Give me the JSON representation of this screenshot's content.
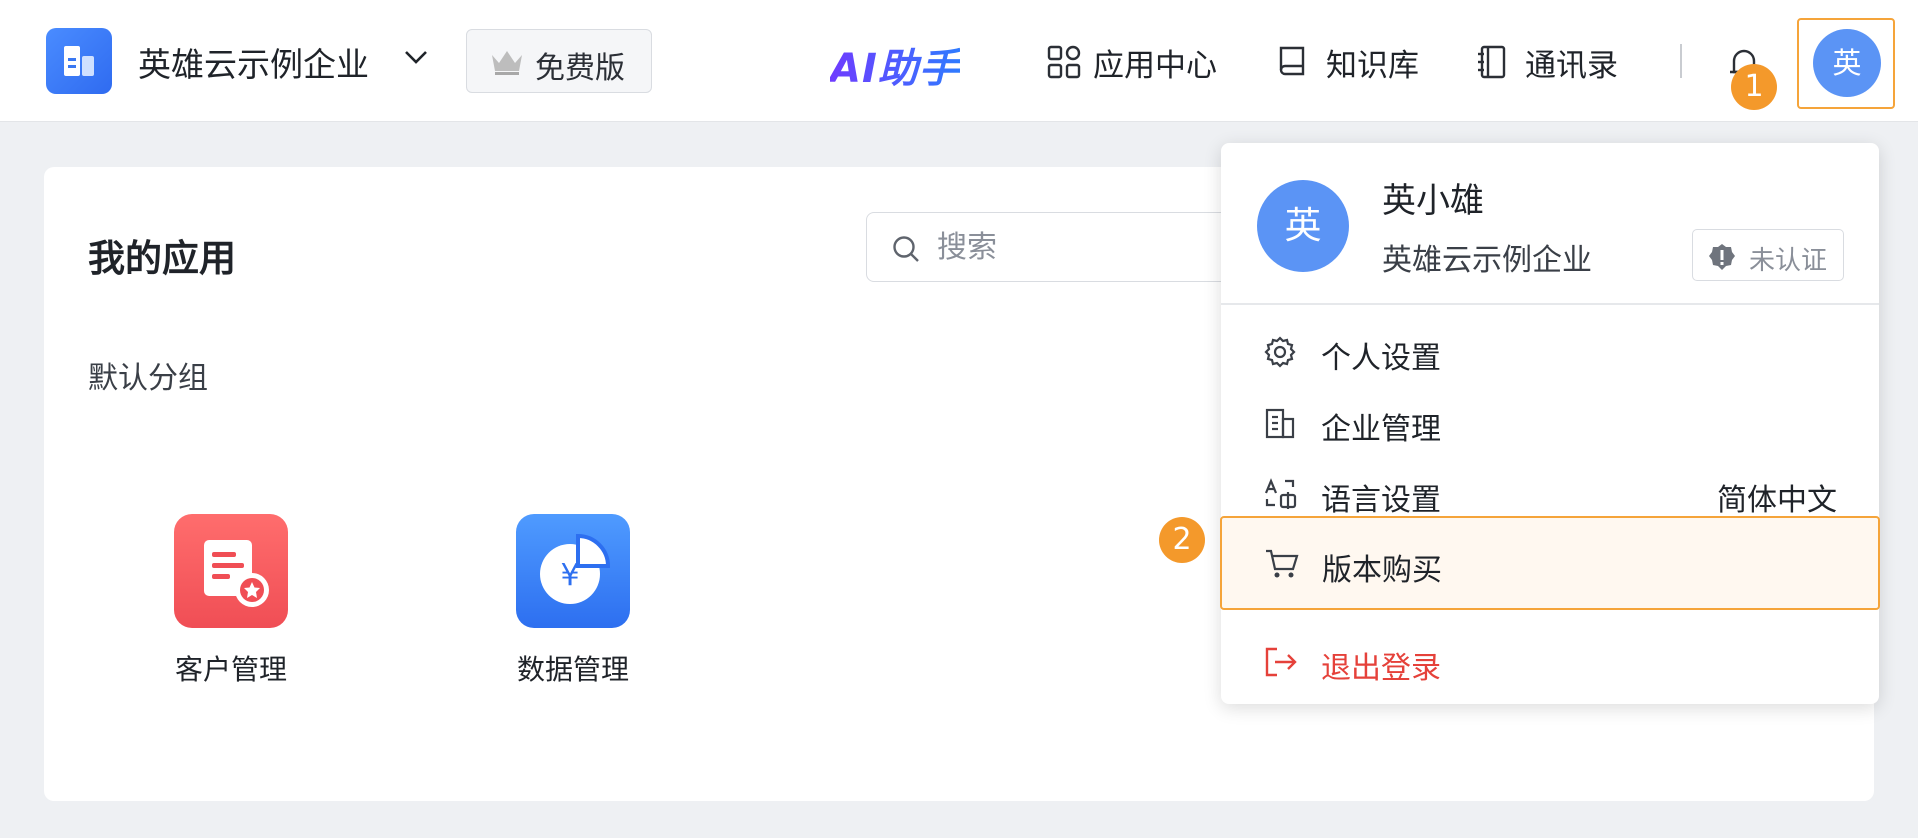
{
  "header": {
    "company": "英雄云示例企业",
    "edition": "免费版",
    "ai_label": "AI助手",
    "nav": [
      "应用中心",
      "知识库",
      "通讯录"
    ],
    "avatar_text": "英",
    "marker_1": "1"
  },
  "main": {
    "title": "我的应用",
    "search_placeholder": "搜索",
    "group_label": "默认分组",
    "apps": [
      {
        "label": "客户管理",
        "icon": "customer-form-icon",
        "color": "#f25c5f"
      },
      {
        "label": "数据管理",
        "icon": "finance-pie-icon",
        "color": "#3f86f6"
      }
    ]
  },
  "dropdown": {
    "avatar_text": "英",
    "user_name": "英小雄",
    "company": "英雄云示例企业",
    "verify_status": "未认证",
    "menu": {
      "personal_settings": "个人设置",
      "enterprise_management": "企业管理",
      "language_settings": "语言设置",
      "language_value": "简体中文",
      "version_purchase": "版本购买",
      "logout": "退出登录"
    },
    "marker_2": "2"
  },
  "colors": {
    "accent_orange": "#f5a43a",
    "marker_orange": "#f4992b",
    "brand_blue": "#3f86f6",
    "logout_red": "#e5413a"
  }
}
